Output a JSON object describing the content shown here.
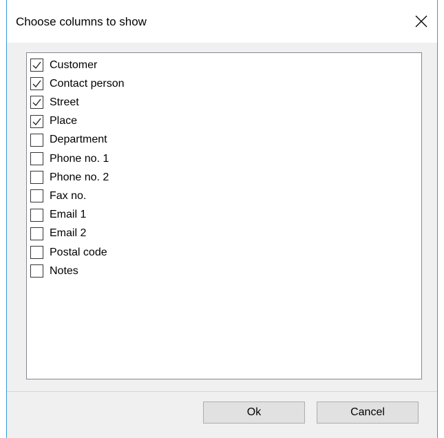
{
  "dialog": {
    "title": "Choose columns to show",
    "close_label": "Close"
  },
  "columns": [
    {
      "label": "Customer",
      "checked": true
    },
    {
      "label": "Contact person",
      "checked": true
    },
    {
      "label": "Street",
      "checked": true
    },
    {
      "label": "Place",
      "checked": true
    },
    {
      "label": "Department",
      "checked": false
    },
    {
      "label": "Phone no. 1",
      "checked": false
    },
    {
      "label": "Phone no. 2",
      "checked": false
    },
    {
      "label": "Fax no.",
      "checked": false
    },
    {
      "label": "Email 1",
      "checked": false
    },
    {
      "label": "Email 2",
      "checked": false
    },
    {
      "label": "Postal code",
      "checked": false
    },
    {
      "label": "Notes",
      "checked": false
    }
  ],
  "buttons": {
    "ok_label": "Ok",
    "cancel_label": "Cancel"
  },
  "colors": {
    "window_border": "#2f9bd8",
    "dialog_background": "#f0f0f0",
    "button_background": "#e1e1e1"
  }
}
